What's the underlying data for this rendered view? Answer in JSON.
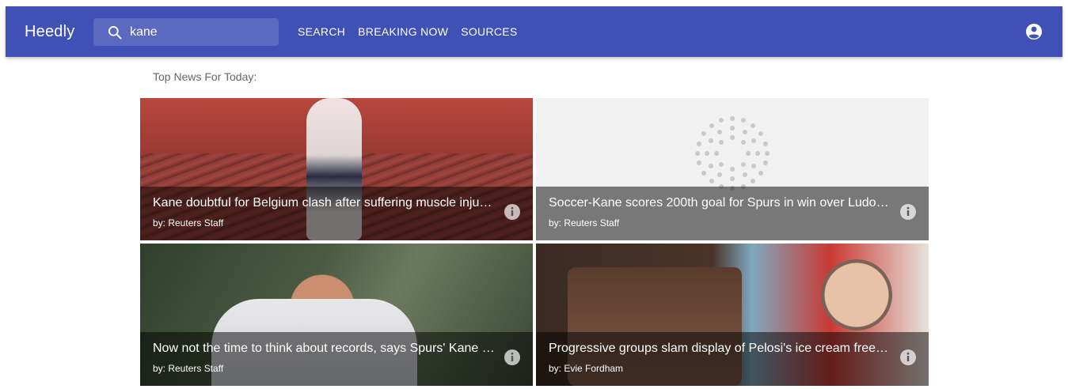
{
  "app": {
    "brand": "Heedly"
  },
  "search": {
    "value": "kane",
    "placeholder": "Search"
  },
  "nav": [
    {
      "label": "SEARCH"
    },
    {
      "label": "BREAKING NOW"
    },
    {
      "label": "SOURCES"
    }
  ],
  "section": {
    "title": "Top News For Today:"
  },
  "articles": [
    {
      "title": "Kane doubtful for Belgium clash after suffering muscle inju…",
      "author": "by: Reuters Staff"
    },
    {
      "title": "Soccer-Kane scores 200th goal for Spurs in win over Ludo…",
      "author": "by: Reuters Staff"
    },
    {
      "title": "Now not the time to think about records, says Spurs' Kane …",
      "author": "by: Reuters Staff"
    },
    {
      "title": "Progressive groups slam display of Pelosi's ice cream free…",
      "author": "by: Evie Fordham"
    }
  ],
  "colors": {
    "appbar": "#3f51b5",
    "overlay": "rgba(0,0,0,0.5)"
  },
  "icons": {
    "search": "search-icon",
    "account": "account-circle-icon",
    "info": "info-icon"
  }
}
